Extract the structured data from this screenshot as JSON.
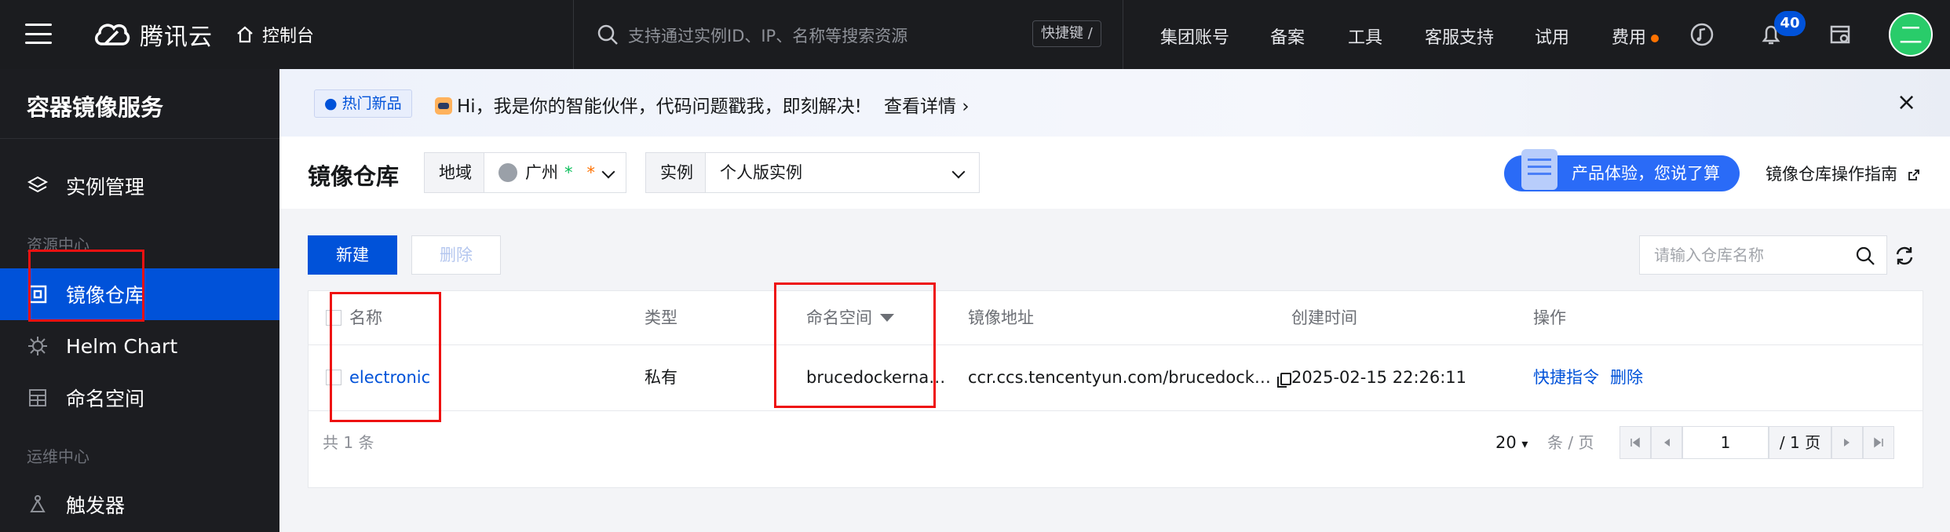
{
  "topbar": {
    "brand": "腾讯云",
    "console": "控制台",
    "search_placeholder": "支持通过实例ID、IP、名称等搜索资源",
    "shortcut": "快捷键 /",
    "menu": [
      "集团账号",
      "备案",
      "工具",
      "客服支持",
      "试用",
      "费用"
    ],
    "notification_count": "40",
    "avatar_initial": "二"
  },
  "sidebar": {
    "title": "容器镜像服务",
    "items": [
      {
        "label": "实例管理",
        "icon": "layers-icon"
      },
      {
        "label": "镜像仓库",
        "icon": "image-repo-icon",
        "active": true
      },
      {
        "label": "Helm Chart",
        "icon": "helm-icon"
      },
      {
        "label": "命名空间",
        "icon": "namespace-icon"
      },
      {
        "label": "触发器",
        "icon": "trigger-icon"
      }
    ],
    "groups": [
      "资源中心",
      "运维中心"
    ]
  },
  "banner": {
    "tag": "热门新品",
    "text": "Hi，我是你的智能伙伴，代码问题戳我，即刻解决!",
    "link": "查看详情"
  },
  "page": {
    "title": "镜像仓库",
    "region_label": "地域",
    "region_value": "广州",
    "instance_label": "实例",
    "instance_value": "个人版实例",
    "promo": "产品体验，您说了算",
    "guide": "镜像仓库操作指南"
  },
  "toolbar": {
    "new_label": "新建",
    "delete_label": "删除",
    "search_placeholder": "请输入仓库名称"
  },
  "table": {
    "headers": [
      "名称",
      "类型",
      "命名空间",
      "镜像地址",
      "创建时间",
      "操作"
    ],
    "rows": [
      {
        "name": "electronic",
        "type": "私有",
        "namespace": "brucedockerna…",
        "address": "ccr.ccs.tencentyun.com/brucedock…",
        "created": "2025-02-15 22:26:11",
        "actions": [
          "快捷指令",
          "删除"
        ]
      }
    ],
    "total": "共 1 条",
    "page_size": "20",
    "page_size_unit": "条 / 页",
    "current_page": "1",
    "total_pages": "/ 1 页"
  },
  "colors": {
    "brand_blue": "#0052d9",
    "topbar_bg": "#1b1c1f",
    "sidebar_bg": "#1c1d21",
    "annotation_red": "#ee1111"
  }
}
